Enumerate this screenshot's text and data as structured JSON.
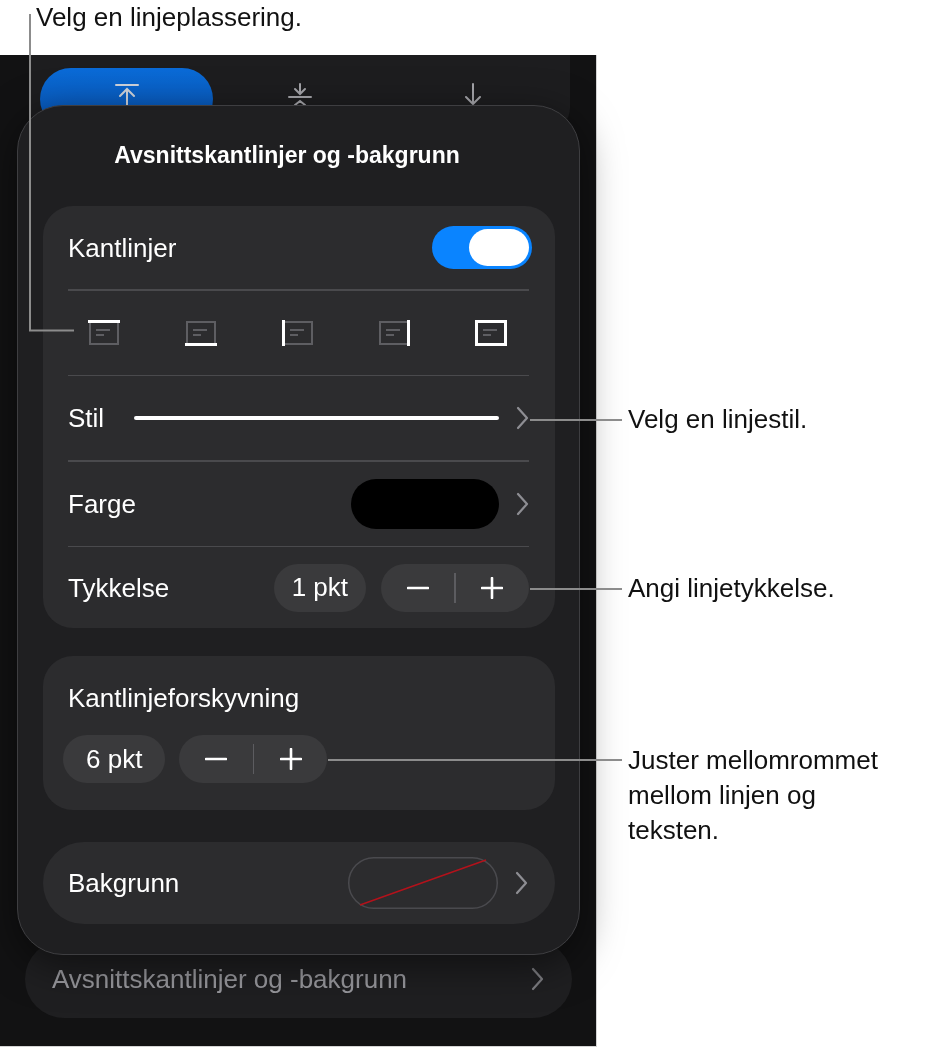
{
  "callouts": [
    {
      "text": "Velg en linjeplassering."
    },
    {
      "text": "Velg en linjestil."
    },
    {
      "text": "Angi linjetykkelse."
    },
    {
      "text": "Juster mellomrommet mellom linjen og teksten."
    }
  ],
  "alignment_segments": [
    {
      "kind": "top",
      "selected": true
    },
    {
      "kind": "middle",
      "selected": false
    },
    {
      "kind": "bottom",
      "selected": false
    }
  ],
  "popover": {
    "title": "Avsnittskantlinjer og -bakgrunn",
    "borders": {
      "label": "Kantlinjer",
      "on": true
    },
    "border_positions": [
      {
        "kind": "top"
      },
      {
        "kind": "bottom"
      },
      {
        "kind": "left"
      },
      {
        "kind": "right"
      },
      {
        "kind": "all"
      }
    ],
    "style": {
      "label": "Stil"
    },
    "color": {
      "label": "Farge",
      "color": "#000000"
    },
    "thickness": {
      "label": "Tykkelse",
      "value": "1 pkt"
    },
    "offset": {
      "label": "Kantlinjeforskyvning",
      "value": "6 pkt"
    },
    "background": {
      "label": "Bakgrunn"
    }
  },
  "behind_row": {
    "label": "Avsnittskantlinjer og -bakgrunn"
  }
}
